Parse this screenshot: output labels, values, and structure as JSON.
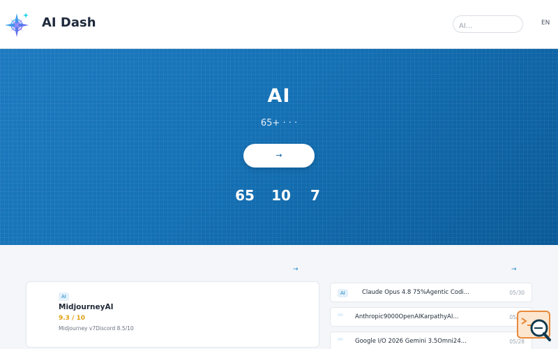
{
  "header": {
    "brand": "AI Dash",
    "nav": [
      "",
      "",
      "",
      "",
      "",
      ""
    ],
    "search_placeholder": "AI...",
    "lang": " EN"
  },
  "colors": {
    "accent": "#0a6bb5",
    "hero_start": "#1d7ac0",
    "hero_end": "#0a5a98",
    "score": "#e0a010",
    "logo_star": "#7c3aed"
  },
  "hero": {
    "title": " AI ",
    "subtitle": "65+  ·  ·  · ",
    "cta": "  →",
    "stats": [
      {
        "value": "65",
        "label": ""
      },
      {
        "value": "10",
        "label": ""
      },
      {
        "value": "7",
        "label": ""
      }
    ]
  },
  "left_section": {
    "title": " ",
    "link": " →",
    "card": {
      "icon": "",
      "tag": "AI",
      "title": "MidjourneyAI",
      "score": " 9.3 / 10",
      "desc": " Midjourney v7Discord     8.5/10"
    }
  },
  "right_section": {
    "title": " ",
    "link": " →",
    "news": [
      {
        "tag": "AI",
        "text": "Claude Opus 4.8 75%Agentic Codi...",
        "date": "05/30"
      },
      {
        "tag": "",
        "text": "Anthropic9000OpenAIKarpathyAI...",
        "date": "05/30"
      },
      {
        "tag": "",
        "text": "Google I/O 2026 Gemini 3.5Omni24...",
        "date": "05/28"
      }
    ]
  },
  "icons": {
    "logo": "compass-star-icon",
    "card_icon": "placeholder-glyph-icon",
    "floating": "chat-search-icon"
  }
}
